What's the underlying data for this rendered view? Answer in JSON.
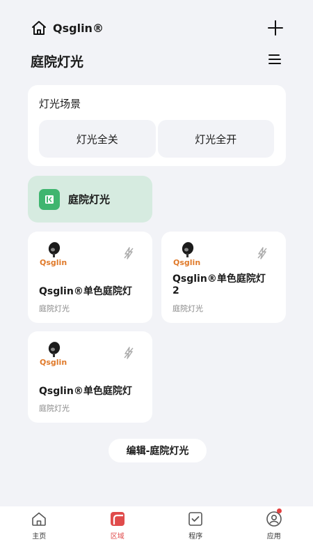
{
  "header": {
    "brand": "Qsglin®",
    "title": "庭院灯光"
  },
  "scenes": {
    "label": "灯光场景",
    "off": "灯光全关",
    "on": "灯光全开"
  },
  "room_tab": {
    "label": "庭院灯光"
  },
  "devices": [
    {
      "name": "Qsglin®单色庭院灯",
      "room": "庭院灯光",
      "logo_text": "Qsglin"
    },
    {
      "name": "Qsglin®单色庭院灯2",
      "room": "庭院灯光",
      "logo_text": "Qsglin"
    },
    {
      "name": "Qsglin®单色庭院灯",
      "room": "庭院灯光",
      "logo_text": "Qsglin"
    }
  ],
  "edit_button": "编辑-庭院灯光",
  "tabs": [
    {
      "label": "主页",
      "icon": "home-icon"
    },
    {
      "label": "区域",
      "icon": "area-icon",
      "active": true
    },
    {
      "label": "程序",
      "icon": "program-icon"
    },
    {
      "label": "应用",
      "icon": "app-icon",
      "badge": true
    }
  ],
  "colors": {
    "accent_green": "#3fb56f",
    "active_red": "#e04b4b",
    "room_tab_bg": "#d6ebe0"
  }
}
